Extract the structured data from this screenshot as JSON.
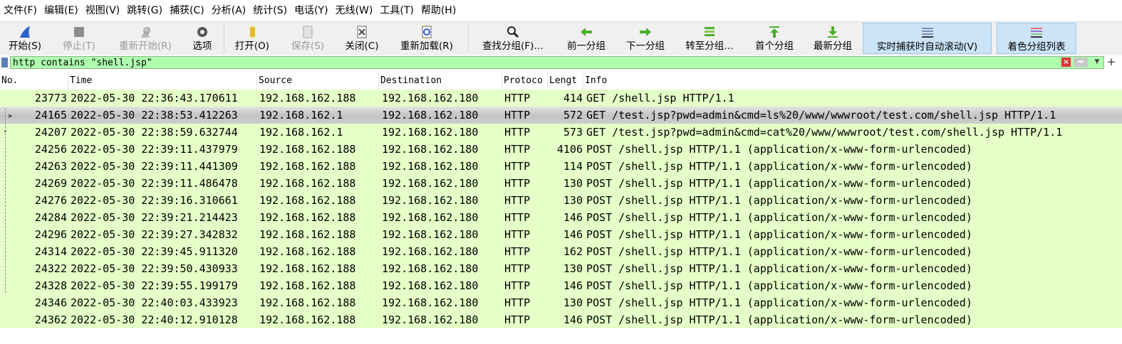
{
  "menu": [
    "文件(F)",
    "编辑(E)",
    "视图(V)",
    "跳转(G)",
    "捕获(C)",
    "分析(A)",
    "统计(S)",
    "电话(Y)",
    "无线(W)",
    "工具(T)",
    "帮助(H)"
  ],
  "toolbar": {
    "start": "开始(S)",
    "stop": "停止(T)",
    "restart": "重新开始(R)",
    "options": "选项",
    "open": "打开(O)",
    "save": "保存(S)",
    "close": "关闭(C)",
    "reload": "重新加载(R)",
    "find": "查找分组(F)…",
    "prev": "前一分组",
    "next": "下一分组",
    "goto": "转至分组…",
    "first": "首个分组",
    "last": "最新分组",
    "autoscroll": "实时捕获时自动滚动(V)",
    "colorize": "着色分组列表"
  },
  "filter": {
    "value": "http contains \"shell.jsp\""
  },
  "columns": {
    "no": "No.",
    "time": "Time",
    "source": "Source",
    "destination": "Destination",
    "protocol": "Protoco",
    "length": "Lengt",
    "info": "Info"
  },
  "packets": [
    {
      "no": "23773",
      "time": "2022-05-30 22:36:43.170611",
      "src": "192.168.162.188",
      "dst": "192.168.162.180",
      "proto": "HTTP",
      "len": "414",
      "info": "GET /shell.jsp HTTP/1.1"
    },
    {
      "no": "24165",
      "time": "2022-05-30 22:38:53.412263",
      "src": "192.168.162.1",
      "dst": "192.168.162.180",
      "proto": "HTTP",
      "len": "572",
      "info": "GET /test.jsp?pwd=admin&cmd=ls%20/www/wwwroot/test.com/shell.jsp HTTP/1.1"
    },
    {
      "no": "24207",
      "time": "2022-05-30 22:38:59.632744",
      "src": "192.168.162.1",
      "dst": "192.168.162.180",
      "proto": "HTTP",
      "len": "573",
      "info": "GET /test.jsp?pwd=admin&cmd=cat%20/www/wwwroot/test.com/shell.jsp HTTP/1.1"
    },
    {
      "no": "24256",
      "time": "2022-05-30 22:39:11.437979",
      "src": "192.168.162.188",
      "dst": "192.168.162.180",
      "proto": "HTTP",
      "len": "4106",
      "info": "POST /shell.jsp HTTP/1.1  (application/x-www-form-urlencoded)"
    },
    {
      "no": "24263",
      "time": "2022-05-30 22:39:11.441309",
      "src": "192.168.162.188",
      "dst": "192.168.162.180",
      "proto": "HTTP",
      "len": "114",
      "info": "POST /shell.jsp HTTP/1.1  (application/x-www-form-urlencoded)"
    },
    {
      "no": "24269",
      "time": "2022-05-30 22:39:11.486478",
      "src": "192.168.162.188",
      "dst": "192.168.162.180",
      "proto": "HTTP",
      "len": "130",
      "info": "POST /shell.jsp HTTP/1.1  (application/x-www-form-urlencoded)"
    },
    {
      "no": "24276",
      "time": "2022-05-30 22:39:16.310661",
      "src": "192.168.162.188",
      "dst": "192.168.162.180",
      "proto": "HTTP",
      "len": "130",
      "info": "POST /shell.jsp HTTP/1.1  (application/x-www-form-urlencoded)"
    },
    {
      "no": "24284",
      "time": "2022-05-30 22:39:21.214423",
      "src": "192.168.162.188",
      "dst": "192.168.162.180",
      "proto": "HTTP",
      "len": "146",
      "info": "POST /shell.jsp HTTP/1.1  (application/x-www-form-urlencoded)"
    },
    {
      "no": "24296",
      "time": "2022-05-30 22:39:27.342832",
      "src": "192.168.162.188",
      "dst": "192.168.162.180",
      "proto": "HTTP",
      "len": "146",
      "info": "POST /shell.jsp HTTP/1.1  (application/x-www-form-urlencoded)"
    },
    {
      "no": "24314",
      "time": "2022-05-30 22:39:45.911320",
      "src": "192.168.162.188",
      "dst": "192.168.162.180",
      "proto": "HTTP",
      "len": "162",
      "info": "POST /shell.jsp HTTP/1.1  (application/x-www-form-urlencoded)"
    },
    {
      "no": "24322",
      "time": "2022-05-30 22:39:50.430933",
      "src": "192.168.162.188",
      "dst": "192.168.162.180",
      "proto": "HTTP",
      "len": "130",
      "info": "POST /shell.jsp HTTP/1.1  (application/x-www-form-urlencoded)"
    },
    {
      "no": "24328",
      "time": "2022-05-30 22:39:55.199179",
      "src": "192.168.162.188",
      "dst": "192.168.162.180",
      "proto": "HTTP",
      "len": "146",
      "info": "POST /shell.jsp HTTP/1.1  (application/x-www-form-urlencoded)"
    },
    {
      "no": "24346",
      "time": "2022-05-30 22:40:03.433923",
      "src": "192.168.162.188",
      "dst": "192.168.162.180",
      "proto": "HTTP",
      "len": "130",
      "info": "POST /shell.jsp HTTP/1.1  (application/x-www-form-urlencoded)"
    },
    {
      "no": "24362",
      "time": "2022-05-30 22:40:12.910128",
      "src": "192.168.162.188",
      "dst": "192.168.162.180",
      "proto": "HTTP",
      "len": "146",
      "info": "POST /shell.jsp HTTP/1.1  (application/x-www-form-urlencoded)"
    }
  ],
  "selected_row_index": 1,
  "colors": {
    "row_bg": "#e4ffc7",
    "filter_bg": "#afffaf",
    "active_btn": "#cce4f7"
  }
}
